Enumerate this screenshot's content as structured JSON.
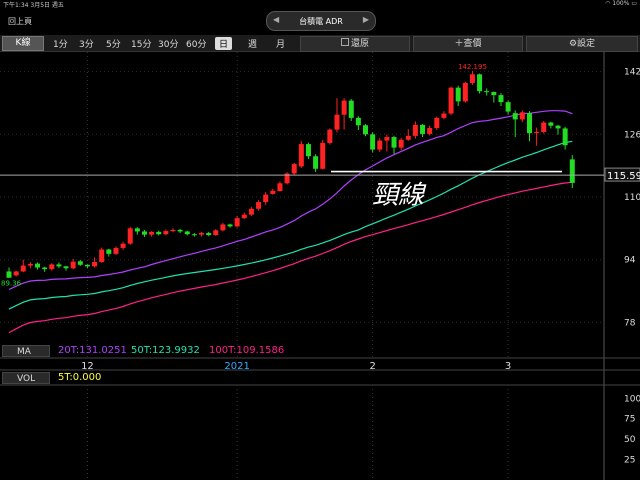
{
  "status_bar": {
    "time_date": "下午1:34  3月5日 週五",
    "battery": "100%"
  },
  "nav": {
    "back_label": "回上頁",
    "title": "台積電 ADR",
    "prev_icon": "chevron-left-icon",
    "next_icon": "chevron-right-icon"
  },
  "toolbar": {
    "chart_type": "K線",
    "periods": [
      "1分",
      "3分",
      "5分",
      "15分",
      "30分",
      "60分",
      "日",
      "週",
      "月"
    ],
    "selected_period": "日",
    "restore_label": "還原",
    "query_label": "查價",
    "settings_label": "設定"
  },
  "ma_panel": {
    "label": "MA",
    "ma20": "20T:131.0251",
    "ma50": "50T:123.9932",
    "ma100": "100T:109.1586"
  },
  "vol_panel": {
    "label": "VOL",
    "vol5": "5T:0.000"
  },
  "colors": {
    "up": "#ff2222",
    "down": "#22dd22",
    "ma20": "#b040ff",
    "ma50": "#20e0b0",
    "ma100": "#ff2288",
    "date_label": "#33aaff",
    "vol5": "#ffff33"
  },
  "chart_data": {
    "type": "candlestick",
    "price_axis": {
      "ticks": [
        142,
        126,
        110,
        94,
        78
      ],
      "range": [
        73,
        147
      ]
    },
    "vol_axis": {
      "ticks": [
        100,
        75,
        50,
        25
      ],
      "range": [
        0,
        115
      ]
    },
    "current_price": "115.59",
    "high_label": "142.195",
    "low_label": "89.36",
    "x_labels": [
      {
        "label": "12",
        "index": 11
      },
      {
        "label": "2021",
        "index": 32
      },
      {
        "label": "2",
        "index": 51
      },
      {
        "label": "3",
        "index": 70
      }
    ],
    "annotation": "頸線",
    "neckline_price": 116.5,
    "candles": [
      [
        91,
        89.4,
        92,
        89.4
      ],
      [
        90,
        91,
        91.2,
        89.7
      ],
      [
        91,
        92.5,
        94,
        90.8
      ],
      [
        92.5,
        92.9,
        93.4,
        91.8
      ],
      [
        93,
        92,
        93.3,
        91.5
      ],
      [
        92,
        91.6,
        92.2,
        90.9
      ],
      [
        91.6,
        92.8,
        93.1,
        91.2
      ],
      [
        92.8,
        92.3,
        93.3,
        91.9
      ],
      [
        92.3,
        91.8,
        92.4,
        91.2
      ],
      [
        91.8,
        93.5,
        94.2,
        91.6
      ],
      [
        93.6,
        92.7,
        93.9,
        92.4
      ],
      [
        92.7,
        92.3,
        92.8,
        91.9
      ],
      [
        92.3,
        93.4,
        94.6,
        92
      ],
      [
        93.4,
        96.6,
        97.1,
        93.2
      ],
      [
        96.6,
        95.5,
        96.8,
        94.8
      ],
      [
        95.5,
        97,
        97.4,
        95.2
      ],
      [
        97,
        98.1,
        98.6,
        96.5
      ],
      [
        98.1,
        102,
        102.4,
        97.8
      ],
      [
        102,
        101.2,
        102.3,
        100.4
      ],
      [
        101.2,
        100.4,
        101.6,
        99.8
      ],
      [
        100.4,
        101.1,
        101.3,
        99.9
      ],
      [
        101.1,
        100.5,
        101.4,
        100.2
      ],
      [
        100.5,
        101.3,
        101.7,
        100.2
      ],
      [
        101.3,
        101.6,
        102,
        101
      ],
      [
        101.6,
        101.2,
        101.9,
        100.8
      ],
      [
        101.2,
        100.5,
        101.4,
        100.2
      ],
      [
        100.5,
        100.4,
        100.8,
        99.9
      ],
      [
        100.4,
        100.8,
        101.1,
        99.9
      ],
      [
        100.8,
        100.3,
        101.1,
        100
      ],
      [
        100.3,
        101.5,
        101.8,
        100.1
      ],
      [
        101.5,
        103,
        103.4,
        101.2
      ],
      [
        103,
        102.5,
        103.2,
        102.2
      ],
      [
        102.5,
        104.6,
        105.2,
        102.2
      ],
      [
        104.6,
        105.5,
        106,
        104.4
      ],
      [
        105.5,
        107,
        107.5,
        105.1
      ],
      [
        107,
        108.7,
        109.2,
        106.5
      ],
      [
        108.7,
        110.6,
        111.3,
        108
      ],
      [
        110.8,
        111.6,
        112.1,
        110.6
      ],
      [
        111.5,
        113.5,
        114,
        111.4
      ],
      [
        113.5,
        116,
        116.3,
        113.2
      ],
      [
        116,
        118.4,
        118.7,
        115.5
      ],
      [
        117.8,
        123.5,
        124.3,
        117.4
      ],
      [
        123.5,
        120.4,
        123.9,
        119.7
      ],
      [
        120.4,
        117.2,
        120.9,
        116.4
      ],
      [
        117.2,
        123.8,
        124.6,
        117
      ],
      [
        123.8,
        127.2,
        127.5,
        123.4
      ],
      [
        127.2,
        131,
        135.2,
        126.5
      ],
      [
        131,
        134.6,
        135.2,
        127.2
      ],
      [
        134.6,
        130.2,
        135,
        129.4
      ],
      [
        130.2,
        128.3,
        130.6,
        127.1
      ],
      [
        128.3,
        126,
        128.6,
        125.5
      ],
      [
        126,
        122.1,
        126.5,
        121.4
      ],
      [
        122.1,
        124.4,
        125,
        121.5
      ],
      [
        124.4,
        125.3,
        125.9,
        121.6
      ],
      [
        125.3,
        122.6,
        125.6,
        120.9
      ],
      [
        122.6,
        124.6,
        125.1,
        122
      ],
      [
        124.6,
        125.6,
        127.3,
        124.3
      ],
      [
        125.6,
        128.4,
        129.3,
        124.9
      ],
      [
        128.4,
        126.1,
        128.6,
        125.3
      ],
      [
        126.1,
        127.6,
        128.2,
        125.7
      ],
      [
        127.6,
        130.2,
        130.5,
        127.1
      ],
      [
        130.2,
        131.3,
        131.9,
        129.8
      ],
      [
        131.3,
        137.9,
        138.2,
        130.9
      ],
      [
        137.9,
        134.4,
        138.4,
        133.2
      ],
      [
        134.4,
        139.1,
        139.4,
        134.1
      ],
      [
        139.1,
        141.3,
        142.2,
        138.6
      ],
      [
        141.3,
        137,
        141.5,
        136.4
      ],
      [
        137,
        136.8,
        137.7,
        135.9
      ],
      [
        136.8,
        136,
        136.9,
        134.1
      ],
      [
        136,
        134.2,
        136.5,
        133.2
      ],
      [
        134.2,
        131.8,
        134.6,
        131
      ],
      [
        131.4,
        129.8,
        132.1,
        125.3
      ],
      [
        129.8,
        131.6,
        132.1,
        129.1
      ],
      [
        131.4,
        126.3,
        131.9,
        124.2
      ],
      [
        126.3,
        126.6,
        127.7,
        123.1
      ],
      [
        126.6,
        129,
        129.4,
        126.2
      ],
      [
        129,
        128.2,
        129.2,
        127.5
      ],
      [
        128.2,
        127.5,
        128.4,
        125.9
      ],
      [
        127.5,
        123.2,
        127.9,
        122.1
      ],
      [
        119.6,
        113.6,
        120.7,
        112.3
      ]
    ]
  }
}
